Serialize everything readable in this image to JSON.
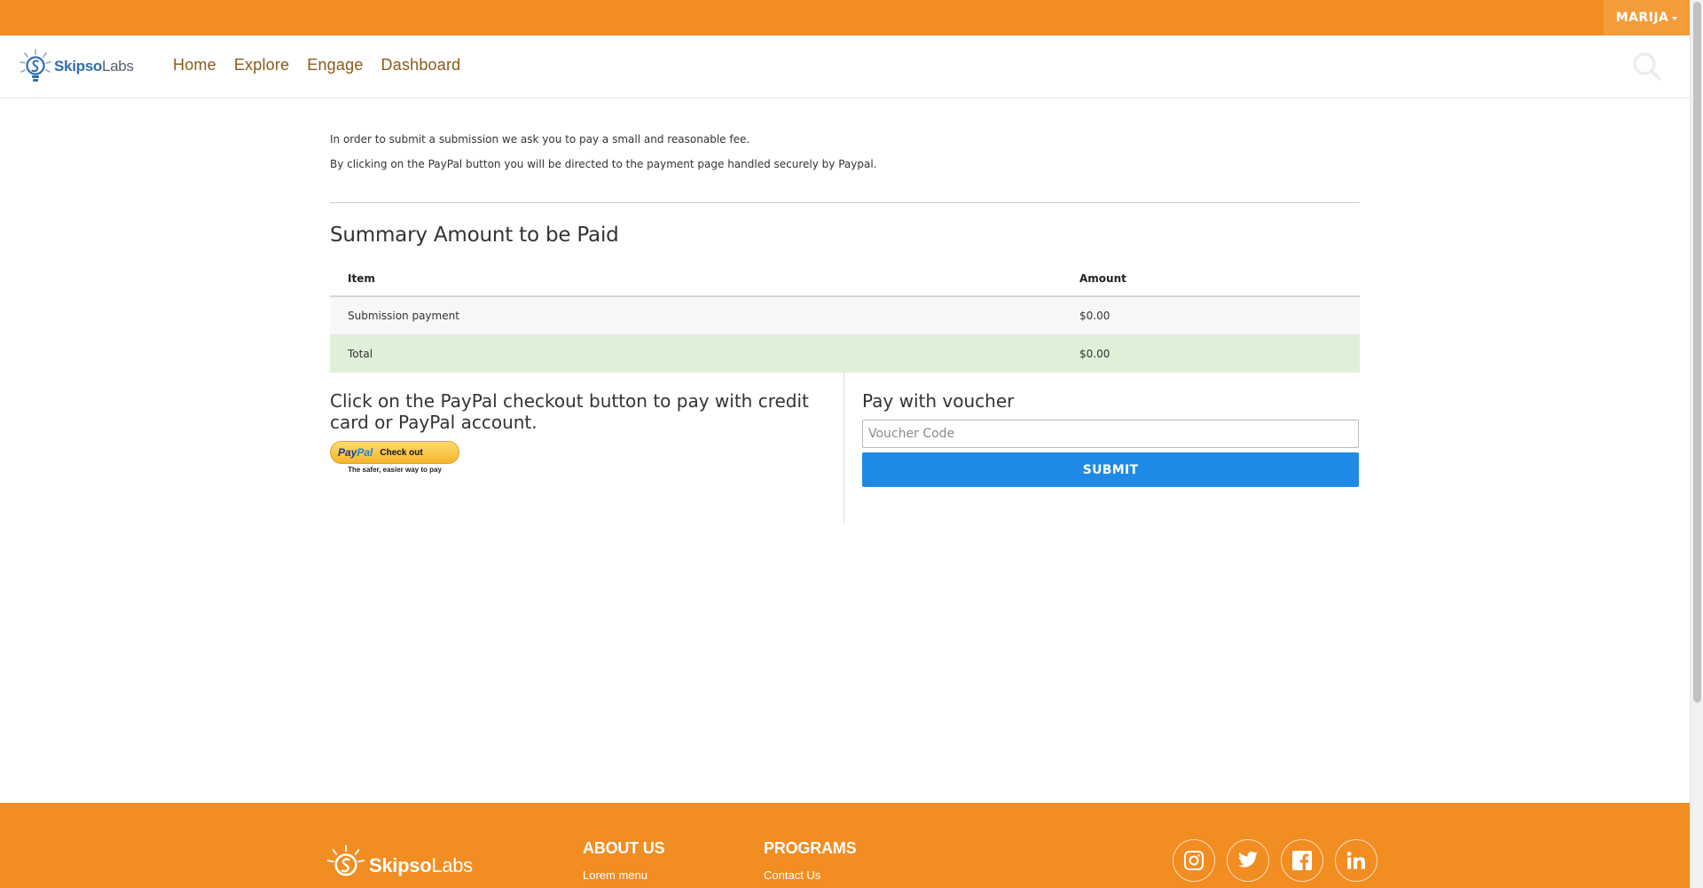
{
  "header": {
    "user_name": "MARIJA",
    "logo": {
      "brand": "Skipso",
      "suffix": "Labs"
    },
    "nav": [
      "Home",
      "Explore",
      "Engage",
      "Dashboard"
    ],
    "search_icon": "search-icon"
  },
  "intro": {
    "line1": "In order to submit a submission we ask you to pay a small and reasonable fee.",
    "line2": "By clicking on the PayPal button you will be directed to the payment page handled securely by Paypal."
  },
  "summary": {
    "title": "Summary Amount to be Paid",
    "columns": [
      "Item",
      "Amount"
    ],
    "rows": [
      {
        "item": "Submission payment",
        "amount": "$0.00"
      },
      {
        "item": "Total",
        "amount": "$0.00"
      }
    ]
  },
  "paypal": {
    "heading": "Click on the PayPal checkout button to pay with credit card or PayPal account.",
    "logo_pay": "Pay",
    "logo_pal": "Pal",
    "button_label": "Check out",
    "tagline": "The safer, easier way to pay"
  },
  "voucher": {
    "heading": "Pay with voucher",
    "placeholder": "Voucher Code",
    "value": "",
    "submit_label": "SUBMIT"
  },
  "footer": {
    "logo": {
      "brand": "Skipso",
      "suffix": "Labs"
    },
    "about": {
      "title": "ABOUT US",
      "link": "Lorem menu"
    },
    "programs": {
      "title": "PROGRAMS",
      "link": "Contact Us"
    },
    "social_icons": [
      "instagram-icon",
      "twitter-icon",
      "facebook-icon",
      "linkedin-icon"
    ]
  },
  "colors": {
    "brand_orange": "#f28d22",
    "nav_link": "#8a5a19",
    "submit_blue": "#1f8ae6",
    "total_row": "#dff0d8"
  }
}
